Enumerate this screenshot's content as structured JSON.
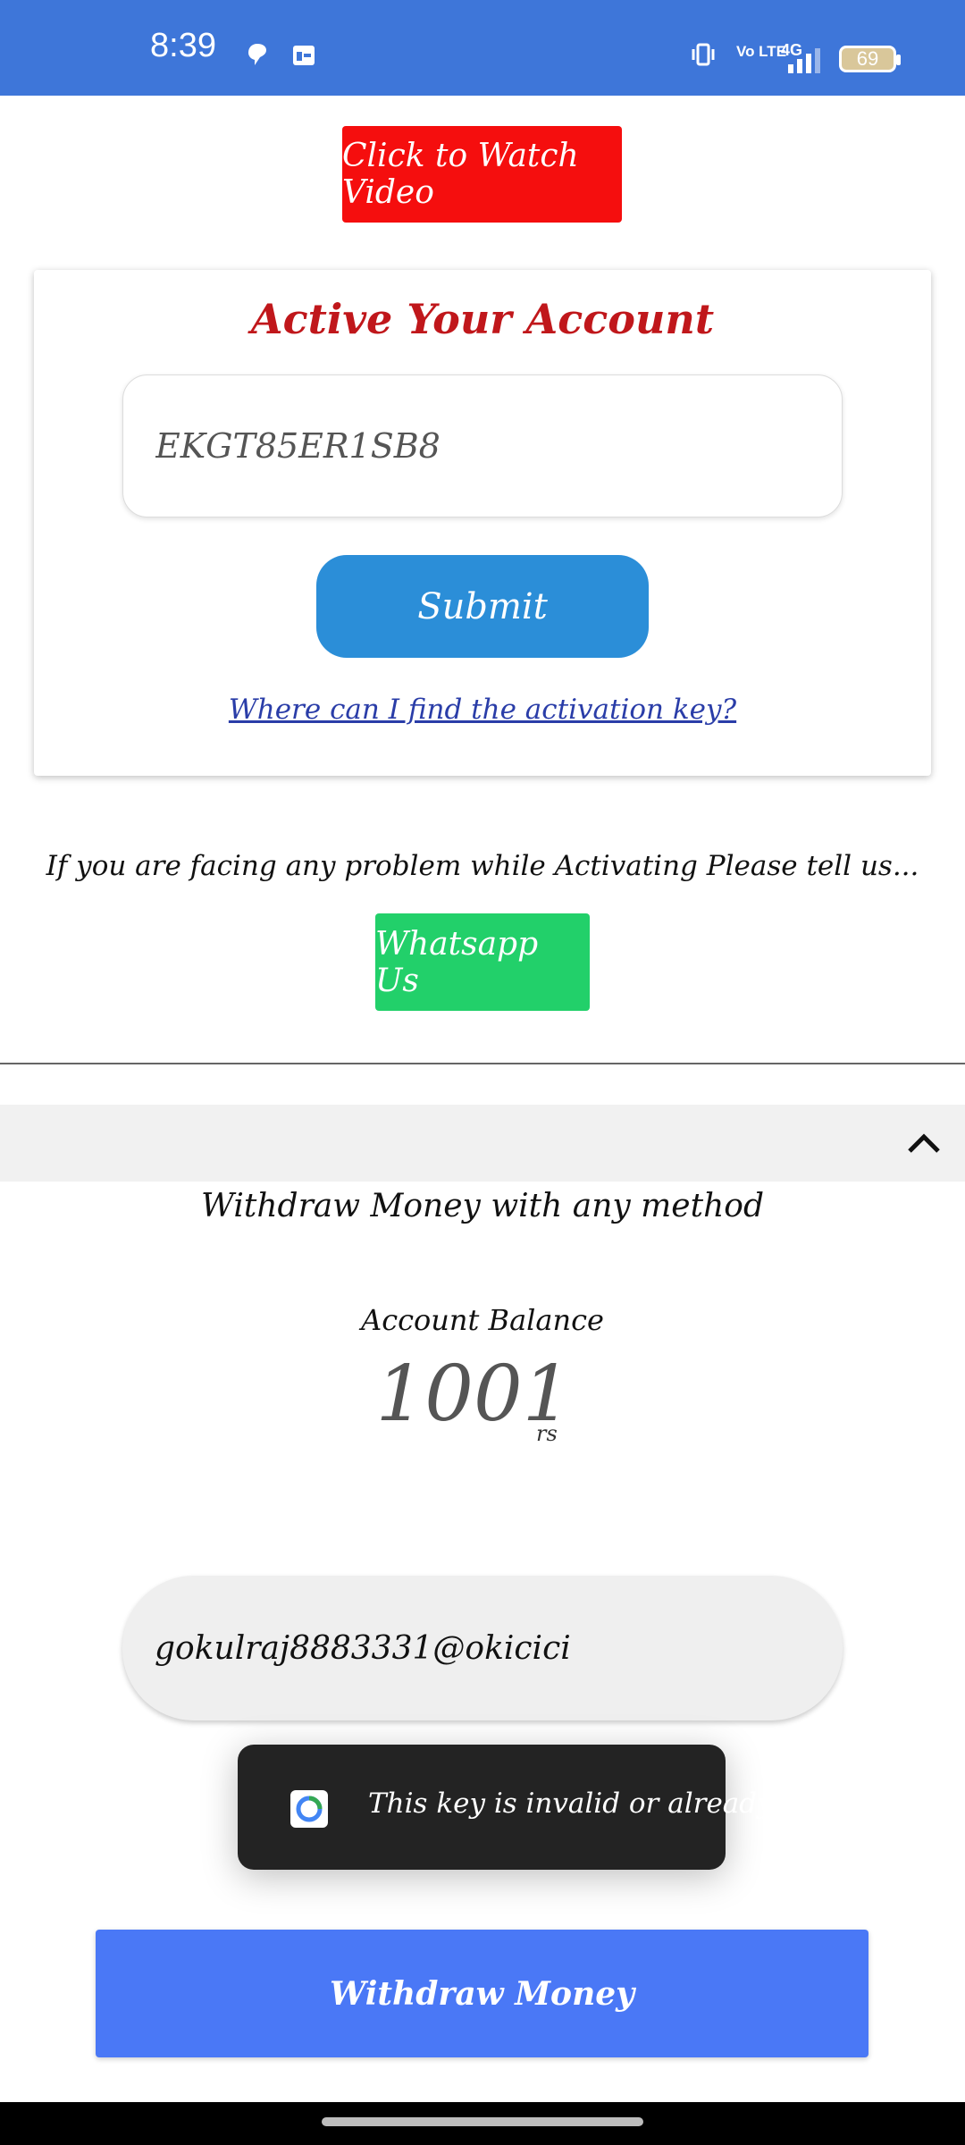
{
  "status_bar": {
    "time": "8:39",
    "network": "4G",
    "volte": "Vo LTE",
    "battery": "69"
  },
  "watch_video": {
    "label": "Click to Watch Video"
  },
  "activation": {
    "title": "Active Your Account",
    "key_value": "EKGT85ER1SB8",
    "submit_label": "Submit",
    "help_link": "Where can I find the activation key?"
  },
  "support": {
    "problem_text": "If you are facing any problem while Activating Please tell us...",
    "whatsapp_label": "Whatsapp Us"
  },
  "withdraw": {
    "heading": "Withdraw Money with any method",
    "balance_label": "Account Balance",
    "balance_value": "1001",
    "balance_unit": "rs",
    "upi_value": "gokulraj8883331@okicici",
    "button_label": "Withdraw Money"
  },
  "toast": {
    "message": "This key is invalid or already use"
  },
  "colors": {
    "status_bar": "#3e76d9",
    "watch_button": "#f50e0e",
    "title": "#c0171b",
    "submit": "#2b8ed8",
    "whatsapp": "#22d06a",
    "withdraw": "#4a78f6"
  }
}
